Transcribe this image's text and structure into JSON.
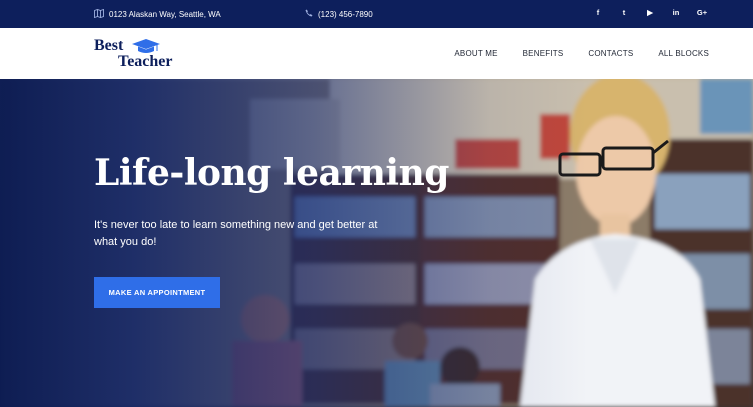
{
  "topbar": {
    "address": "0123 Alaskan Way, Seattle, WA",
    "phone": "(123) 456-7890",
    "social": [
      {
        "label": "f",
        "icon": "facebook-icon"
      },
      {
        "label": "t",
        "icon": "twitter-icon"
      },
      {
        "label": "▶",
        "icon": "youtube-icon"
      },
      {
        "label": "in",
        "icon": "linkedin-icon"
      },
      {
        "label": "G+",
        "icon": "google-plus-icon"
      }
    ]
  },
  "brand": {
    "line1": "Best",
    "line2": "Teacher"
  },
  "nav": [
    {
      "label": "ABOUT ME"
    },
    {
      "label": "BENEFITS"
    },
    {
      "label": "CONTACTS"
    },
    {
      "label": "ALL BLOCKS"
    }
  ],
  "hero": {
    "headline": "Life-long learning",
    "subtext": "It's never too late to learn something new and get better at what you do!",
    "cta_label": "MAKE AN APPOINTMENT"
  },
  "colors": {
    "topbar_bg": "#0d1f5c",
    "brand": "#0d1f5c",
    "cta": "#2f6ee8",
    "overlay": "#102468"
  }
}
